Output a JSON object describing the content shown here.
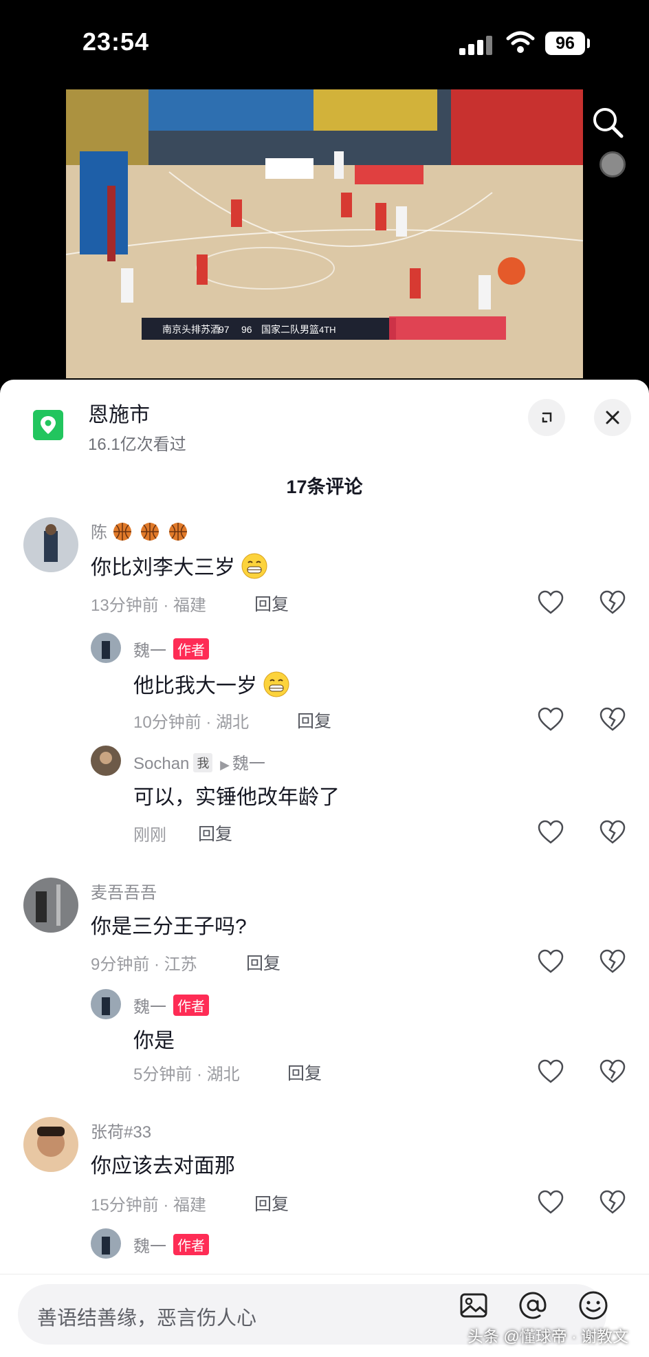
{
  "status_bar": {
    "time": "23:54",
    "battery": "96"
  },
  "video": {
    "home_team": "南京头排苏酒",
    "home_score": "97",
    "away_score": "96",
    "away_team": "国家二队男篮",
    "period": "4TH"
  },
  "location": {
    "title": "恩施市",
    "subtitle": "16.1亿次看过"
  },
  "comments_title": "17条评论",
  "comments": [
    {
      "name": "陈",
      "text": "你比刘李大三岁",
      "time": "13分钟前 · 福建",
      "reply": "回复"
    },
    {
      "name": "魏一",
      "tag": "作者",
      "text": "他比我大一岁",
      "time": "10分钟前 · 湖北",
      "reply": "回复"
    },
    {
      "name": "Sochan",
      "tag": "我",
      "reply_to": "魏一",
      "text": "可以，实锤他改年龄了",
      "time": "刚刚",
      "reply": "回复"
    },
    {
      "name": "麦吾吾吾",
      "text": "你是三分王子吗?",
      "time": "9分钟前 · 江苏",
      "reply": "回复"
    },
    {
      "name": "魏一",
      "tag": "作者",
      "text": "你是",
      "time": "5分钟前 · 湖北",
      "reply": "回复"
    },
    {
      "name": "张荷#33",
      "text": "你应该去对面那",
      "time": "15分钟前 · 福建",
      "reply": "回复"
    },
    {
      "name": "魏一",
      "tag": "作者"
    }
  ],
  "input": {
    "placeholder": "善语结善缘，恶言伤人心"
  },
  "watermark": "头条 @懂球帝 · 谢教文",
  "colors": {
    "accent": "#fe2c55",
    "location_green": "#22c55e"
  },
  "icons": [
    "search-icon",
    "location-pin-icon",
    "expand-icon",
    "close-icon",
    "heart-icon",
    "dislike-icon",
    "image-icon",
    "at-icon",
    "emoji-icon",
    "basketball-icon",
    "grin-emoji-icon"
  ]
}
